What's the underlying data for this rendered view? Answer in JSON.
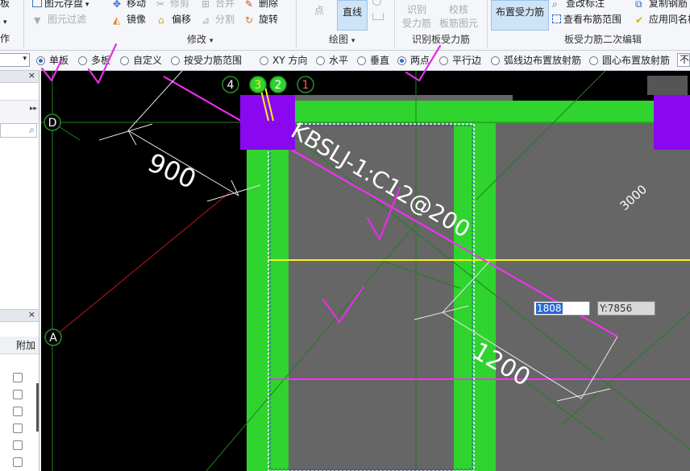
{
  "ribbon": {
    "left_items": [
      "板",
      "作"
    ],
    "group1": {
      "title": "修改",
      "buttons": {
        "element_store": "图元存盘",
        "move": "移动",
        "trim": "修剪",
        "merge": "合并",
        "delete": "删除",
        "element_filter": "图元过滤",
        "mirror": "镜像",
        "offset": "偏移",
        "split": "分割",
        "rotate": "旋转"
      }
    },
    "group2": {
      "title": "绘图",
      "point": "点",
      "line": "直线"
    },
    "group3": {
      "title": "识别板受力筋",
      "identify1": "识别",
      "identify2": "受力筋",
      "check1": "校核",
      "check2": "板筋图元"
    },
    "group4": {
      "title": "板受力筋二次编辑",
      "layout_bars": "布置受力筋",
      "find_annot": "查改标注",
      "view_range": "查看布筋范围",
      "copy_bars": "复制钢筋",
      "apply_same": "应用同名板"
    }
  },
  "optbar": {
    "options": [
      "单板",
      "多板",
      "自定义",
      "按受力筋范围",
      "XY 方向",
      "水平",
      "垂直",
      "两点",
      "平行边",
      "弧线边布置放射筋",
      "圆心布置放射筋"
    ],
    "selected": [
      "单板",
      "两点"
    ],
    "truncated": "不平"
  },
  "left_panel": {
    "header": "附加",
    "close": "×",
    "expand": "▸▸"
  },
  "canvas": {
    "axis_labels": [
      "4",
      "3",
      "2",
      "1",
      "D",
      "A"
    ],
    "rebar_label": "KBSLJ-1:C12@200",
    "dim_900": "900",
    "dim_1200": "1200",
    "dim_3000": "3000",
    "coord_x": "1808",
    "coord_y": "Y:7856"
  },
  "colors": {
    "beam": "#2fd42f",
    "slab": "#666666",
    "magenta": "#ff2bff",
    "purple": "#8a08f0",
    "yellow": "#f7f21a"
  }
}
